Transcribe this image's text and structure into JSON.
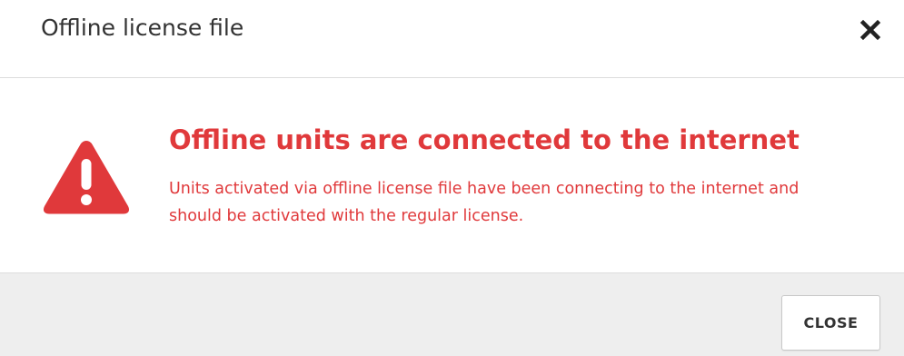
{
  "dialog": {
    "title": "Offline license file",
    "close_icon": "close-x-icon"
  },
  "alert": {
    "icon": "warning-triangle-icon",
    "title": "Offline units are connected to the internet",
    "message": "Units activated via offline license file have been connecting to the internet and should be activated with the regular license."
  },
  "footer": {
    "close_label": "CLOSE"
  },
  "colors": {
    "alert": "#e0393b",
    "title_text": "#333333",
    "footer_bg": "#eeeeee",
    "divider": "#dcdcdc"
  }
}
